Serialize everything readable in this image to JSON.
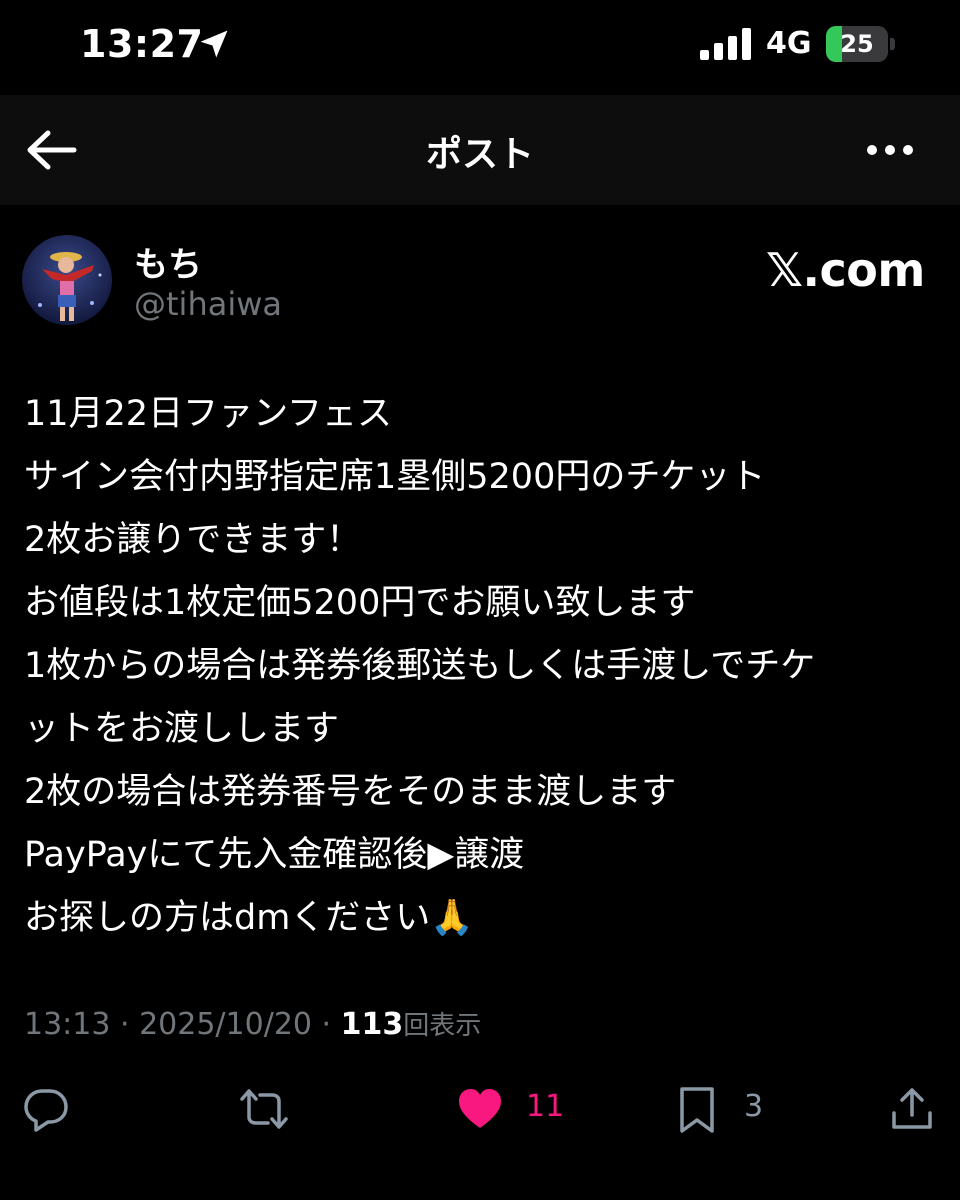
{
  "status_bar": {
    "time": "13:27",
    "network": "4G",
    "battery": "25",
    "battery_level_percent": 25,
    "icons": [
      "location-arrow-icon",
      "signal-bars-icon",
      "battery-charging-icon"
    ]
  },
  "nav": {
    "title": "ポスト",
    "back_icon": "back-arrow-icon",
    "more_icon": "more-dots-icon"
  },
  "post": {
    "display_name": "もち",
    "handle": "@tihaiwa",
    "watermark": "𝕏.com",
    "lines": [
      "11月22日ファンフェス",
      "サイン会付内野指定席1塁側5200円のチケット",
      "2枚お譲りできます！",
      "お値段は1枚定価5200円でお願い致します",
      "1枚からの場合は発券後郵送もしくは手渡しでチケ",
      "ットをお渡しします",
      "2枚の場合は発券番号をそのまま渡します",
      "PayPayにて先入金確認後▶︎譲渡",
      "お探しの方はdmください🙏"
    ],
    "meta": {
      "time": "13:13",
      "separator": " · ",
      "date": "2025/10/20",
      "views_count": "113",
      "views_label": "回表示"
    },
    "actions": {
      "reply_icon": "reply-icon",
      "repost_icon": "repost-icon",
      "like_icon": "heart-icon",
      "like_count": "11",
      "bookmark_icon": "bookmark-icon",
      "bookmark_count": "3",
      "share_icon": "share-icon"
    }
  },
  "colors": {
    "background": "#000000",
    "nav_background": "#0d0d0d",
    "text": "#ffffff",
    "muted": "#71767b",
    "like": "#f91880",
    "battery": "#34c759"
  }
}
